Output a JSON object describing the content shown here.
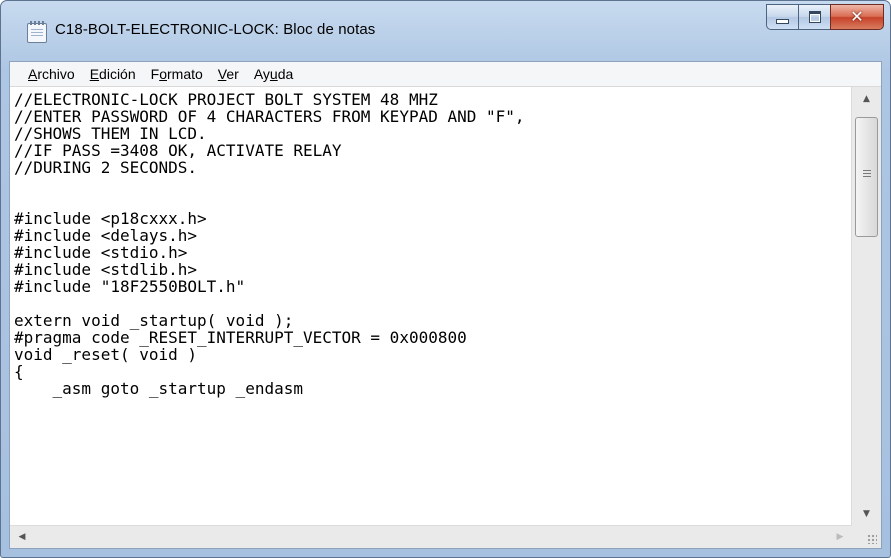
{
  "window": {
    "title": "C18-BOLT-ELECTRONIC-LOCK: Bloc de notas"
  },
  "menu": [
    {
      "label": "Archivo",
      "access": "A",
      "rest": "rchivo",
      "pre": ""
    },
    {
      "label": "Edición",
      "access": "E",
      "rest": "dición",
      "pre": ""
    },
    {
      "label": "Formato",
      "access": "o",
      "rest": "rmato",
      "pre": "F"
    },
    {
      "label": "Ver",
      "access": "V",
      "rest": "er",
      "pre": ""
    },
    {
      "label": "Ayuda",
      "access": "u",
      "rest": "da",
      "pre": "Ay"
    }
  ],
  "editor": {
    "lines": [
      "//ELECTRONIC-LOCK PROJECT BOLT SYSTEM 48 MHZ",
      "//ENTER PASSWORD OF 4 CHARACTERS FROM KEYPAD AND \"F\",",
      "//SHOWS THEM IN LCD.",
      "//IF PASS =3408 OK, ACTIVATE RELAY",
      "//DURING 2 SECONDS.",
      "",
      "",
      "#include <p18cxxx.h>",
      "#include <delays.h>",
      "#include <stdio.h>",
      "#include <stdlib.h>",
      "#include \"18F2550BOLT.h\"",
      "",
      "extern void _startup( void );",
      "#pragma code _RESET_INTERRUPT_VECTOR = 0x000800",
      "void _reset( void )",
      "{",
      "    _asm goto _startup _endasm"
    ]
  },
  "icons": {
    "app": "notepad-icon",
    "minimize": "minimize-icon",
    "maximize": "maximize-icon",
    "close": "close-icon"
  }
}
